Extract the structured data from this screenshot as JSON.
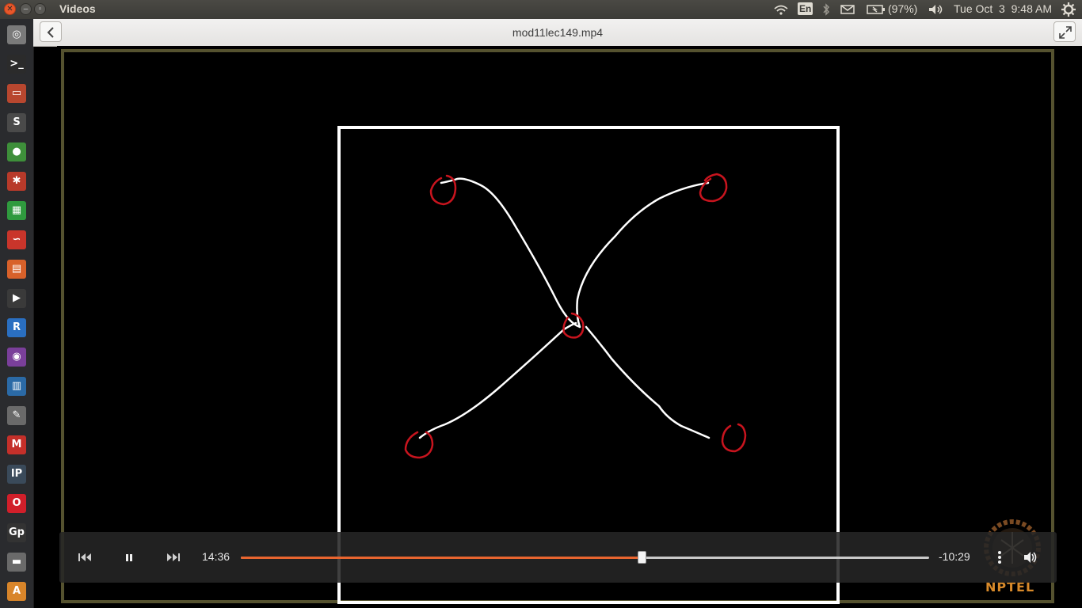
{
  "window": {
    "app_title": "Videos",
    "close_icon": "close-icon",
    "minimize_icon": "minimize-icon",
    "maximize_icon": "maximize-icon"
  },
  "tray": {
    "keyboard_layout": "En",
    "battery": "(97%)",
    "datetime": "Tue Oct  3  9:48 AM",
    "icons": [
      "wifi-icon",
      "keyboard-icon",
      "bluetooth-icon",
      "mail-icon",
      "battery-icon",
      "volume-icon",
      "settings-gear-icon"
    ]
  },
  "launcher": {
    "items": [
      {
        "name": "dash-icon",
        "glyph": "◎",
        "color": "#7a7a7a"
      },
      {
        "name": "terminal-icon",
        "glyph": ">_",
        "color": "#2b2b2b"
      },
      {
        "name": "archive-manager-icon",
        "glyph": "▭",
        "color": "#b8472f"
      },
      {
        "name": "sublime-text-icon",
        "glyph": "S",
        "color": "#4a4a4a"
      },
      {
        "name": "chrome-icon",
        "glyph": "●",
        "color": "#3e8f3a"
      },
      {
        "name": "unity-tweak-icon",
        "glyph": "✱",
        "color": "#b83a2a"
      },
      {
        "name": "spreadsheet-icon",
        "glyph": "▦",
        "color": "#2f9a3e"
      },
      {
        "name": "evince-icon",
        "glyph": "∽",
        "color": "#c9352b"
      },
      {
        "name": "presentation-icon",
        "glyph": "▤",
        "color": "#d8612a"
      },
      {
        "name": "video-player-icon",
        "glyph": "▶",
        "color": "#3a3a3a"
      },
      {
        "name": "r-language-icon",
        "glyph": "R",
        "color": "#2a6fc1"
      },
      {
        "name": "media-icon",
        "glyph": "◉",
        "color": "#7a3f9a"
      },
      {
        "name": "writer-icon",
        "glyph": "▥",
        "color": "#2b6aa6"
      },
      {
        "name": "text-editor-icon",
        "glyph": "✎",
        "color": "#6a6a6a"
      },
      {
        "name": "gmail-icon",
        "glyph": "M",
        "color": "#c4302a"
      },
      {
        "name": "ipython-icon",
        "glyph": "IP",
        "color": "#3a4a5a"
      },
      {
        "name": "opera-icon",
        "glyph": "O",
        "color": "#d11f2a"
      },
      {
        "name": "gp-icon",
        "glyph": "Gp",
        "color": "#333333"
      },
      {
        "name": "disk-icon",
        "glyph": "▬",
        "color": "#6a6a6a"
      },
      {
        "name": "software-center-icon",
        "glyph": "A",
        "color": "#d8852a"
      },
      {
        "name": "files-icon",
        "glyph": "▤",
        "color": "#8a3a6a"
      }
    ]
  },
  "header": {
    "title": "mod11lec149.mp4",
    "back_icon": "chevron-left-icon",
    "fullscreen_icon": "fullscreen-icon"
  },
  "video": {
    "watermark": "NPTEL",
    "accent": "#e9652f"
  },
  "controls": {
    "elapsed": "14:36",
    "remaining": "-10:29",
    "progress": 0.582,
    "icons": [
      "skip-back-icon",
      "pause-icon",
      "skip-forward-icon",
      "menu-dots-icon",
      "volume-icon"
    ]
  }
}
